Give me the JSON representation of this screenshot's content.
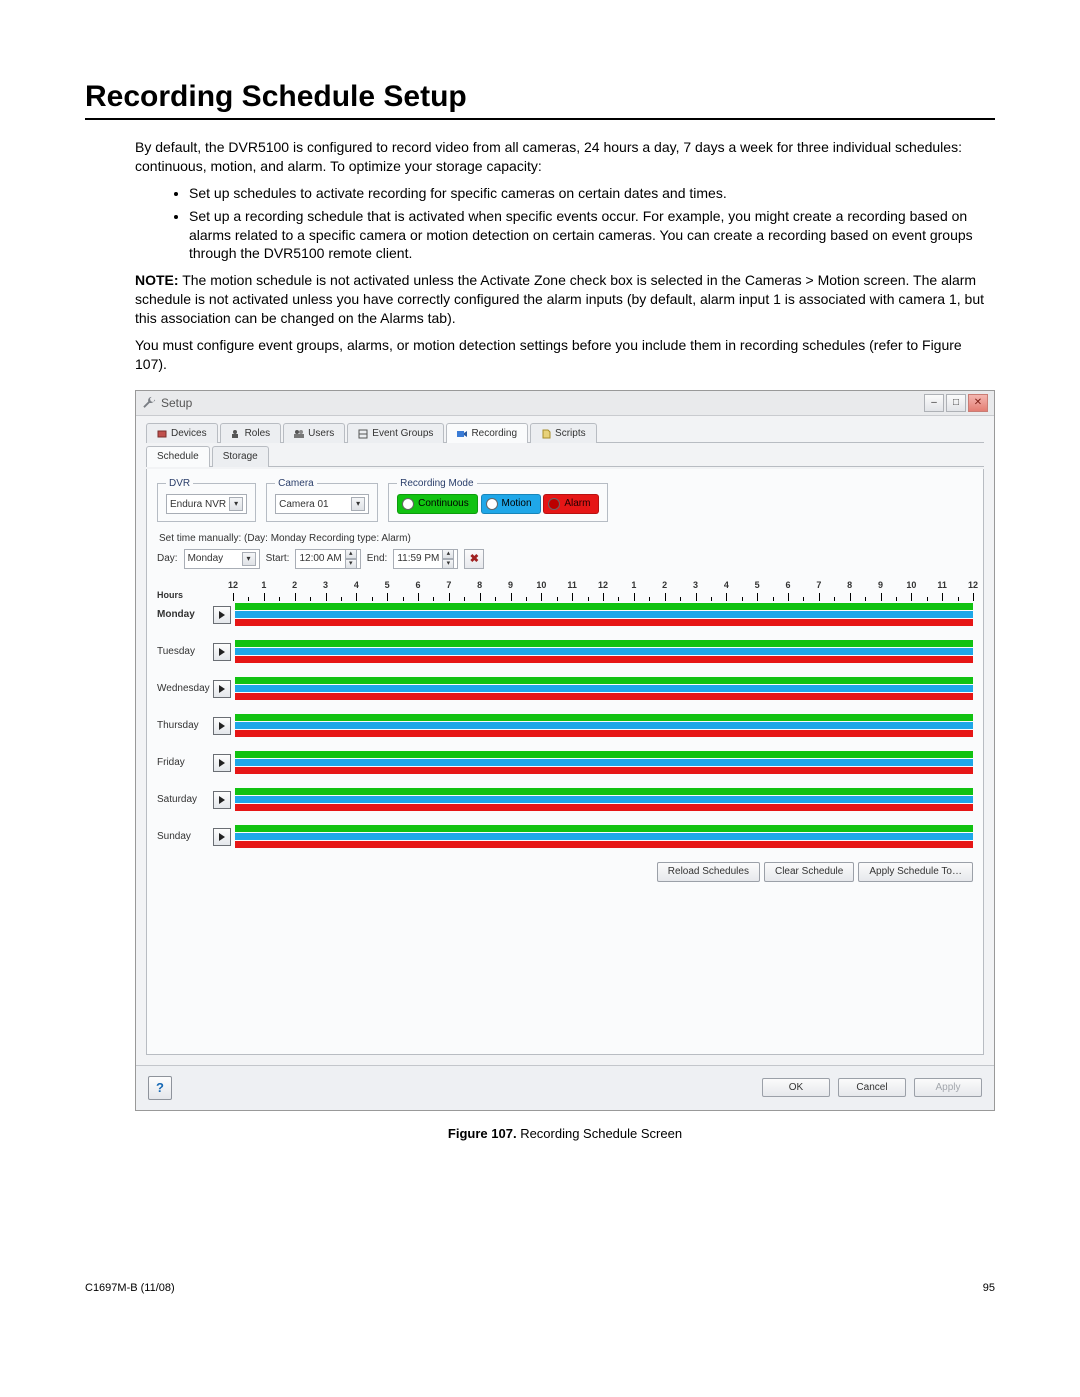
{
  "doc": {
    "heading": "Recording Schedule Setup",
    "intro": "By default, the DVR5100 is configured to record video from all cameras, 24 hours a day, 7 days a week for three individual schedules: continuous, motion, and alarm. To optimize your storage capacity:",
    "bullets": [
      "Set up schedules to activate recording for specific cameras on certain dates and times.",
      "Set up a recording schedule that is activated when specific events occur. For example, you might create a recording based on alarms related to a specific camera or motion detection on certain cameras. You can create a recording based on event groups through the DVR5100 remote client."
    ],
    "note_label": "NOTE:",
    "note_text": "The motion schedule is not activated unless the Activate Zone check box is selected in the Cameras > Motion screen. The alarm schedule is not activated unless you have correctly configured the alarm inputs (by default, alarm input 1 is associated with camera 1, but this association can be changed on the Alarms tab).",
    "must_configure": "You must configure event groups, alarms, or motion detection settings before you include them in recording schedules (refer to Figure 107).",
    "figure_num": "Figure 107.",
    "figure_title": "Recording Schedule Screen",
    "doc_code": "C1697M-B (11/08)",
    "page_num": "95"
  },
  "window": {
    "title": "Setup",
    "tabs_main": [
      "Devices",
      "Roles",
      "Users",
      "Event Groups",
      "Recording",
      "Scripts"
    ],
    "active_main_tab": "Recording",
    "tabs_sub": [
      "Schedule",
      "Storage"
    ],
    "active_sub_tab": "Schedule",
    "dvr_legend": "DVR",
    "dvr_value": "Endura NVR",
    "camera_legend": "Camera",
    "camera_value": "Camera 01",
    "recmode_legend": "Recording Mode",
    "recmode_continuous": "Continuous",
    "recmode_motion": "Motion",
    "recmode_alarm": "Alarm",
    "manual_label": "Set time manually: (Day: Monday  Recording type: Alarm)",
    "day_label": "Day:",
    "day_value": "Monday",
    "start_label": "Start:",
    "start_value": "12:00 AM",
    "end_label": "End:",
    "end_value": "11:59 PM",
    "hours_label": "Hours",
    "hours": [
      "12",
      "1",
      "2",
      "3",
      "4",
      "5",
      "6",
      "7",
      "8",
      "9",
      "10",
      "11",
      "12",
      "1",
      "2",
      "3",
      "4",
      "5",
      "6",
      "7",
      "8",
      "9",
      "10",
      "11",
      "12"
    ],
    "days": [
      "Monday",
      "Tuesday",
      "Wednesday",
      "Thursday",
      "Friday",
      "Saturday",
      "Sunday"
    ],
    "btn_reload": "Reload Schedules",
    "btn_clear": "Clear Schedule",
    "btn_apply_to": "Apply Schedule To…",
    "btn_ok": "OK",
    "btn_cancel": "Cancel",
    "btn_apply": "Apply"
  }
}
